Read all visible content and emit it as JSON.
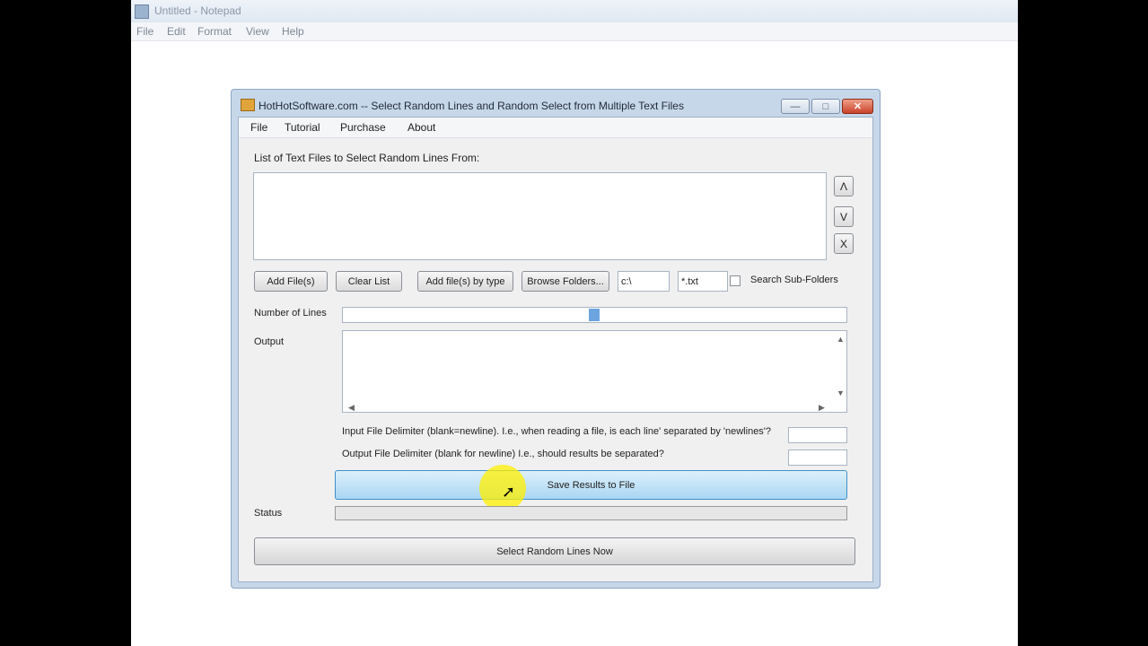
{
  "notepad": {
    "title": "Untitled - Notepad",
    "menu": [
      "File",
      "Edit",
      "Format",
      "View",
      "Help"
    ]
  },
  "dialog": {
    "title": "HotHotSoftware.com -- Select Random Lines and Random Select from Multiple Text Files",
    "window_buttons": {
      "minimize": "—",
      "maximize": "□",
      "close": "✕"
    },
    "menu": [
      "File",
      "Tutorial",
      "Purchase",
      "About"
    ],
    "file_list_label": "List of Text Files to Select Random Lines From:",
    "side_buttons": {
      "up": "Λ",
      "down": "V",
      "remove": "X"
    },
    "buttons": {
      "add_files": "Add File(s)",
      "clear_list": "Clear List",
      "add_by_type": "Add file(s) by type",
      "browse_folders": "Browse Folders..."
    },
    "folder_path": "c:\\",
    "file_mask": "*.txt",
    "search_subfolders_label": "Search Sub-Folders",
    "search_subfolders_checked": false,
    "number_of_lines_label": "Number of Lines",
    "number_of_lines_value": "",
    "output_label": "Output",
    "input_delim_label": "Input File Delimiter (blank=newline). I.e., when reading a file, is each line' separated by 'newlines'?",
    "output_delim_label": "Output File Delimiter (blank for newline) I.e., should results be separated?",
    "save_button": "Save Results to File",
    "status_label": "Status",
    "run_button": "Select Random Lines Now",
    "accent_color": "#a9d6f3"
  }
}
